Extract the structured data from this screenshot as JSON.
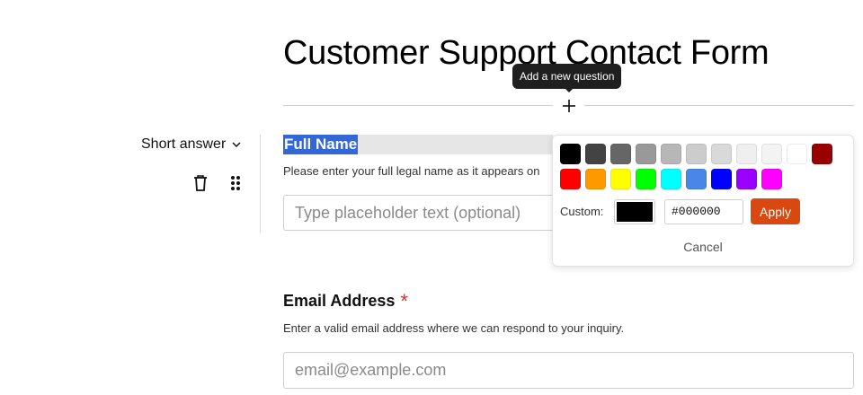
{
  "form": {
    "title": "Customer Support Contact Form"
  },
  "add_question": {
    "tooltip": "Add a new question",
    "icon": "plus-icon"
  },
  "question1": {
    "type_label": "Short answer",
    "title": "Full Name",
    "description": "Please enter your full legal name as it appears on",
    "placeholder": "Type placeholder text (optional)"
  },
  "question2": {
    "title": "Email Address",
    "required_marker": "*",
    "description": "Enter a valid email address where we can respond to your inquiry.",
    "placeholder": "email@example.com"
  },
  "color_picker": {
    "swatch_rows": [
      [
        "#000000",
        "#434343",
        "#666666",
        "#999999",
        "#b7b7b7",
        "#cccccc",
        "#d9d9d9",
        "#efefef",
        "#f3f3f3",
        "#ffffff",
        "#980000"
      ],
      [
        "#ff0000",
        "#ff9900",
        "#ffff00",
        "#00ff00",
        "#00ffff",
        "#4a86e8",
        "#0000ff",
        "#9900ff",
        "#ff00ff"
      ]
    ],
    "custom_label": "Custom:",
    "custom_value": "#000000",
    "apply_label": "Apply",
    "cancel_label": "Cancel"
  },
  "colors": {
    "accent": "#d9480f",
    "selection": "#3367d6",
    "required": "#d32f2f",
    "tooltip_bg": "#1f1f1f"
  }
}
